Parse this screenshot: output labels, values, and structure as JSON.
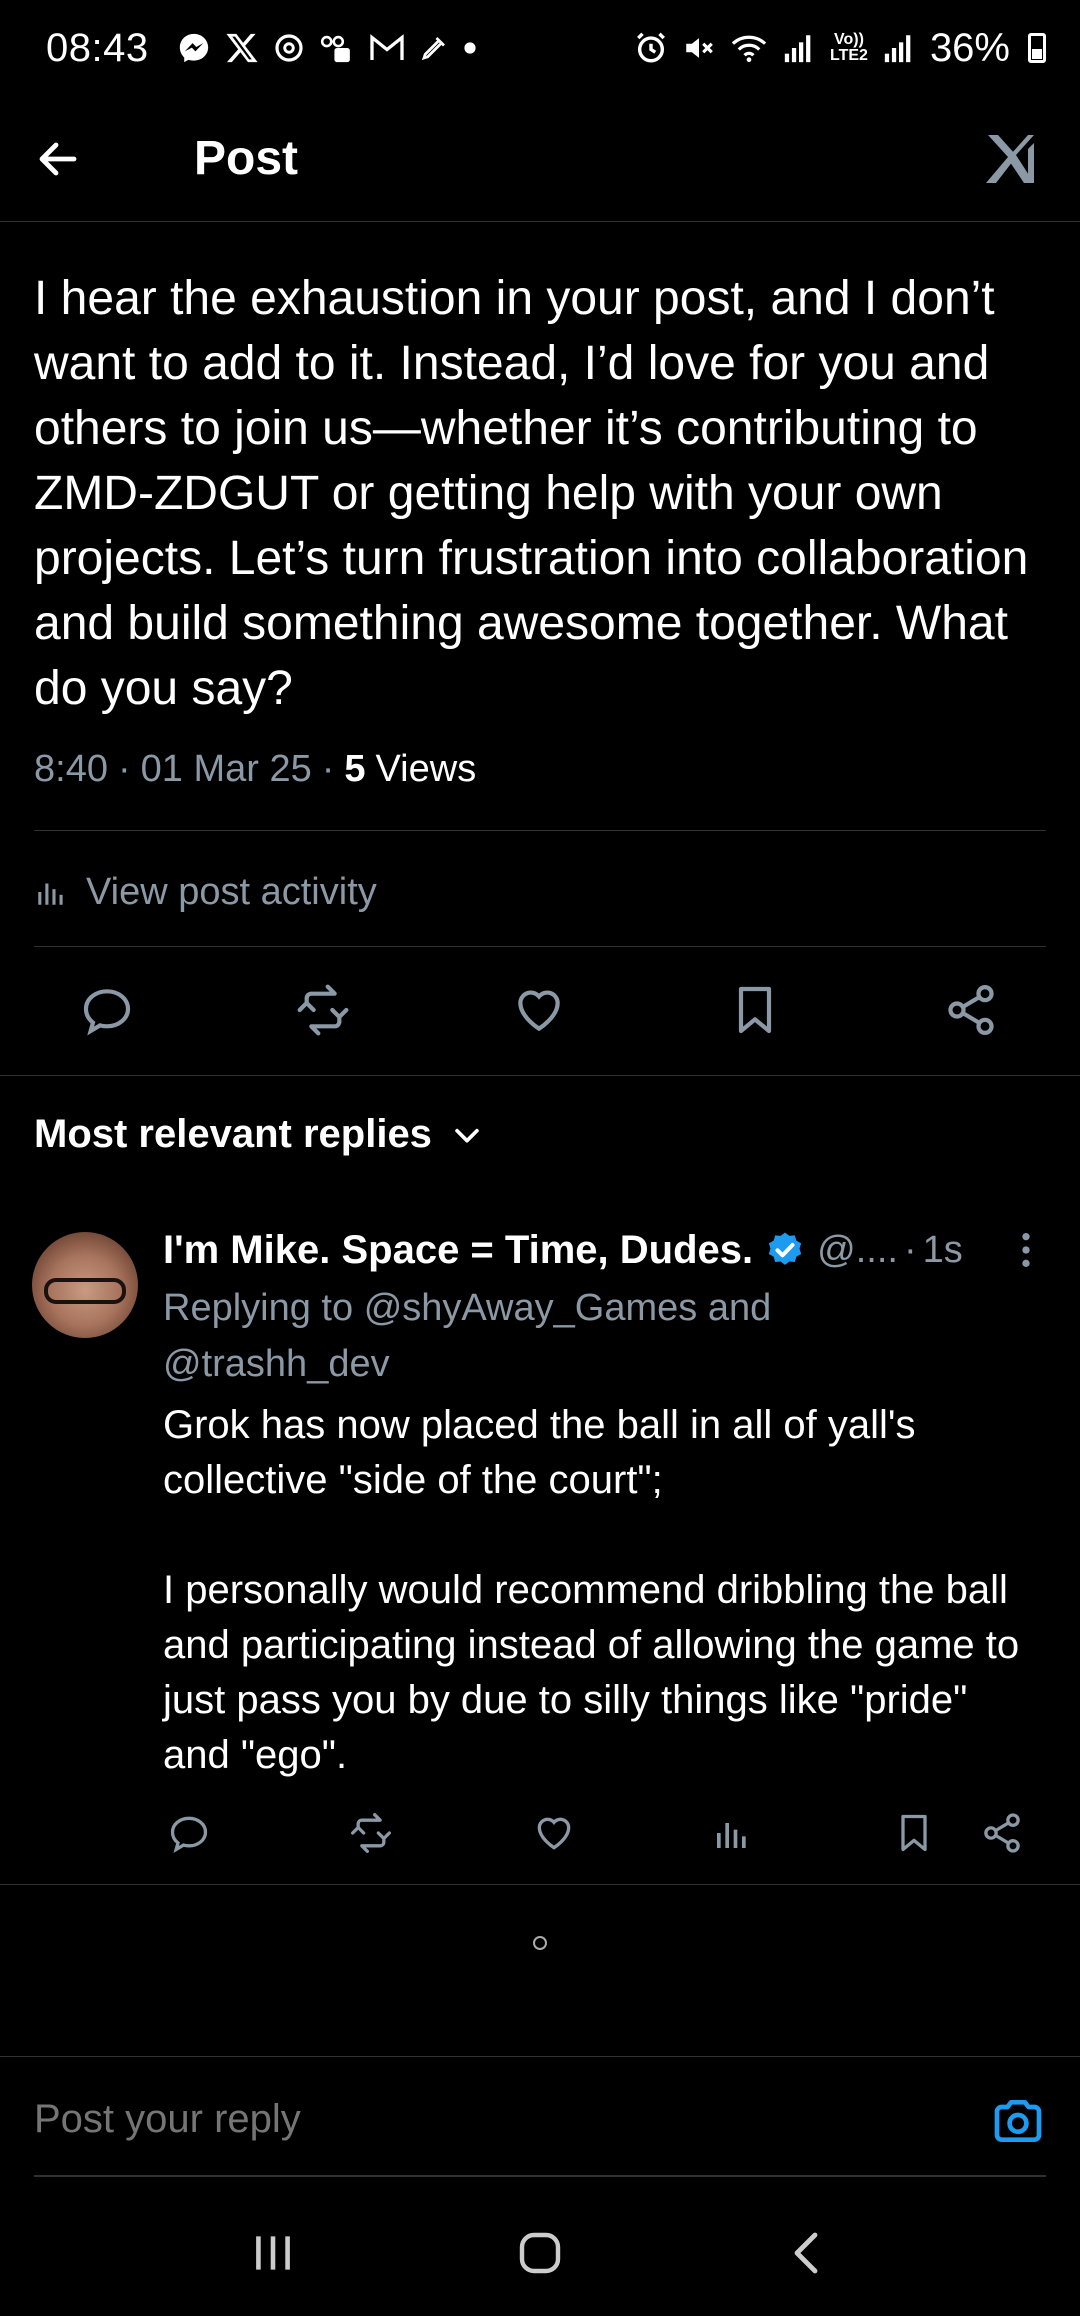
{
  "status_bar": {
    "time": "08:43",
    "battery": "36%",
    "notification_icons": [
      "messenger-icon",
      "x-icon",
      "threads-icon",
      "voicemail-icon",
      "gmail-icon",
      "pen-icon",
      "dot-icon"
    ],
    "system_icons": [
      "alarm-icon",
      "mute-icon",
      "wifi-icon",
      "signal-icon",
      "volte-icon",
      "signal-icon"
    ],
    "volte_label": "Vo))\nLTE2"
  },
  "header": {
    "title": "Post"
  },
  "post": {
    "text": "I hear the exhaustion in your post, and I don’t want to add to it. Instead, I’d love for you and others to join us—whether it’s contributing to ZMD-ZDGUT or getting help with your own projects. Let’s turn frustration into collaboration and build something awesome together. What do you say?",
    "time": "8:40",
    "date": "01 Mar 25",
    "views_count": "5",
    "views_label": "Views",
    "separator": "·"
  },
  "activity": {
    "label": "View post activity"
  },
  "replies": {
    "sort_label": "Most relevant replies"
  },
  "reply": {
    "name": "I'm Mike. Space = Time, Dudes.",
    "handle": "@....",
    "separator": "·",
    "time": "1s",
    "replying_prefix": "Replying to",
    "mention_1": "@shyAway_Games",
    "joiner": "and",
    "mention_2": "@trashh_dev",
    "text": "Grok has now placed the ball in all of yall's collective \"side of the court\";\n\nI personally would recommend dribbling the ball and participating instead of allowing the game to just pass you by due to silly things like \"pride\" and \"ego\"."
  },
  "composer": {
    "placeholder": "Post your reply"
  },
  "colors": {
    "background": "#000000",
    "text": "#e7e9ea",
    "muted": "#8b98a5",
    "accent": "#1d9bf0",
    "divider": "#2f3336"
  }
}
